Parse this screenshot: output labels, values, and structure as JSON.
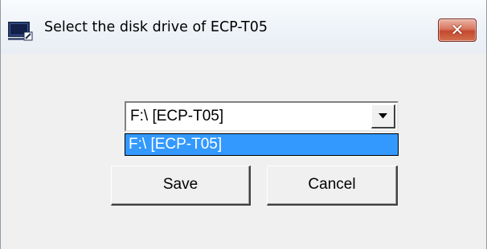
{
  "window": {
    "title": "Select the disk drive of ECP-T05",
    "close_symbol": "✕",
    "icon": "app-window-icon"
  },
  "drive_select": {
    "selected_value": "F:\\ [ECP-T05]",
    "options": [
      "F:\\ [ECP-T05]"
    ],
    "highlighted_option": "F:\\ [ECP-T05]",
    "highlight_color": "#3399ff"
  },
  "buttons": {
    "save_label": "Save",
    "cancel_label": "Cancel"
  },
  "colors": {
    "close_button": "#c4492e",
    "dialog_background": "#f0f0f0"
  }
}
